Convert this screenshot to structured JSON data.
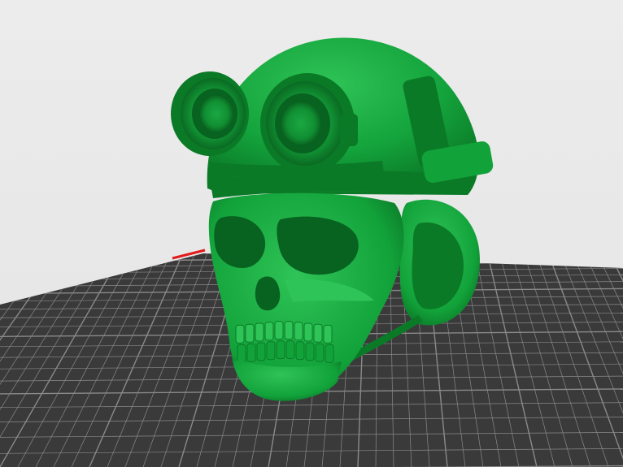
{
  "viewport": {
    "background_color": "#ececec",
    "plate_color": "#3a3a3a",
    "plate_grid_color": "#8a8a8a",
    "model_color": "#12a23a",
    "model_shadow_color": "#0b7a27",
    "model_highlight_color": "#2fc457",
    "x_axis_color": "#e21b1b"
  },
  "model": {
    "icon": "skull-helmet-model"
  }
}
